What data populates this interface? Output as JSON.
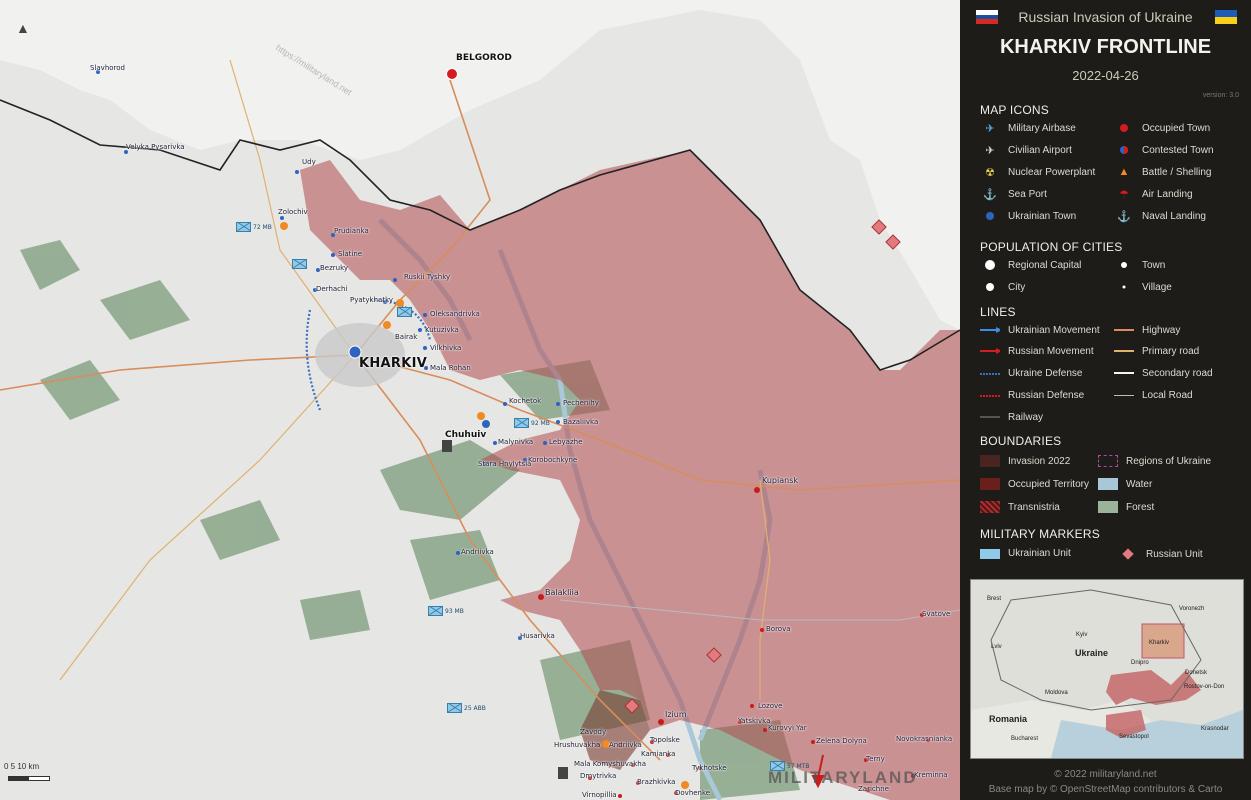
{
  "map": {
    "watermark": "https://militaryland.net",
    "scale_label": "0    5    10 km",
    "brand": "MILITARYLAND",
    "cities": {
      "kharkiv": "KHARKIV",
      "belgorod": "BELGOROD",
      "chuhuiv": "Chuhuiv",
      "kupiansk": "Kupiansk",
      "izium": "Izium",
      "balakliia": "Balakliia"
    },
    "places": [
      "Slavhorod",
      "Velyka Pysarivka",
      "Udy",
      "Zolochiv",
      "Prudianka",
      "Slatine",
      "Bezruky",
      "Derhachi",
      "Ruskii Tyshky",
      "Pyatykhatky",
      "Oleksandrivka",
      "Kutuzivka",
      "Bairak",
      "Vilkhivka",
      "Mala Rohan",
      "Kochetok",
      "Pechenihy",
      "Bazaliivka",
      "Malynivka",
      "Lebyazhe",
      "Stara Hnylytsia",
      "Korobochkyne",
      "Andriivka",
      "Husarivka",
      "Borova",
      "Svatove",
      "Lozove",
      "Yatskivka",
      "Kurovyi Yar",
      "Zelena Dolyna",
      "Novokrasnianka",
      "Terny",
      "Hrushuvakha",
      "Zavody",
      "Andriivka",
      "Topolske",
      "Mala Komyshuvakha",
      "Kamianka",
      "Tykhotske",
      "Dmytrivka",
      "Brazhkivka",
      "Virnopillia",
      "Dovhenke",
      "Kreminna",
      "Zarichne"
    ],
    "units": [
      "72 MB",
      "92 MB",
      "93 MB",
      "25 ABB",
      "57 MTB"
    ],
    "colors": {
      "occupied": "#b34a50",
      "forest": "#7c9c7b",
      "water": "#a8c8d8",
      "ukraine_unit": "#8fcbe8",
      "russian_unit": "#e27a7f"
    }
  },
  "panel": {
    "subtitle": "Russian Invasion of Ukraine",
    "title": "KHARKIV FRONTLINE",
    "date": "2022-04-26",
    "version": "version: 3.0",
    "sections": {
      "icons": "MAP ICONS",
      "population": "POPULATION OF CITIES",
      "lines": "LINES",
      "boundaries": "BOUNDARIES",
      "military": "MILITARY MARKERS"
    },
    "icons": [
      {
        "label": "Military Airbase",
        "icon": "airbase-icon"
      },
      {
        "label": "Occupied Town",
        "icon": "occupied-town-icon"
      },
      {
        "label": "Civilian Airport",
        "icon": "airport-icon"
      },
      {
        "label": "Contested Town",
        "icon": "contested-town-icon"
      },
      {
        "label": "Nuclear Powerplant",
        "icon": "nuclear-icon"
      },
      {
        "label": "Battle / Shelling",
        "icon": "fire-icon"
      },
      {
        "label": "Sea Port",
        "icon": "anchor-icon"
      },
      {
        "label": "Air Landing",
        "icon": "parachute-icon"
      },
      {
        "label": "Ukrainian Town",
        "icon": "ukrainian-town-icon"
      },
      {
        "label": "Naval Landing",
        "icon": "naval-landing-icon"
      }
    ],
    "population": [
      "Regional Capital",
      "Town",
      "City",
      "Village"
    ],
    "lines": [
      "Ukrainian Movement",
      "Highway",
      "Russian Movement",
      "Primary road",
      "Ukraine Defense",
      "Secondary road",
      "Russian Defense",
      "Local Road",
      "Railway"
    ],
    "boundaries": [
      "Invasion 2022",
      "Regions of Ukraine",
      "Occupied Territory",
      "Water",
      "Transnistria",
      "Forest"
    ],
    "military": [
      "Ukrainian Unit",
      "Russian Unit"
    ],
    "inset": {
      "labels": [
        "Brest",
        "Voronezh",
        "Kyiv",
        "Ukraine",
        "Kharkiv",
        "Lviv",
        "Dnipro",
        "Donetsk",
        "Rostov-on-Don",
        "Moldova",
        "Romania",
        "Bucharest",
        "Krasnodar",
        "Sevastopol"
      ]
    },
    "copyright": "© 2022 militaryland.net",
    "basemap": "Base map by © OpenStreetMap contributors & Carto"
  }
}
